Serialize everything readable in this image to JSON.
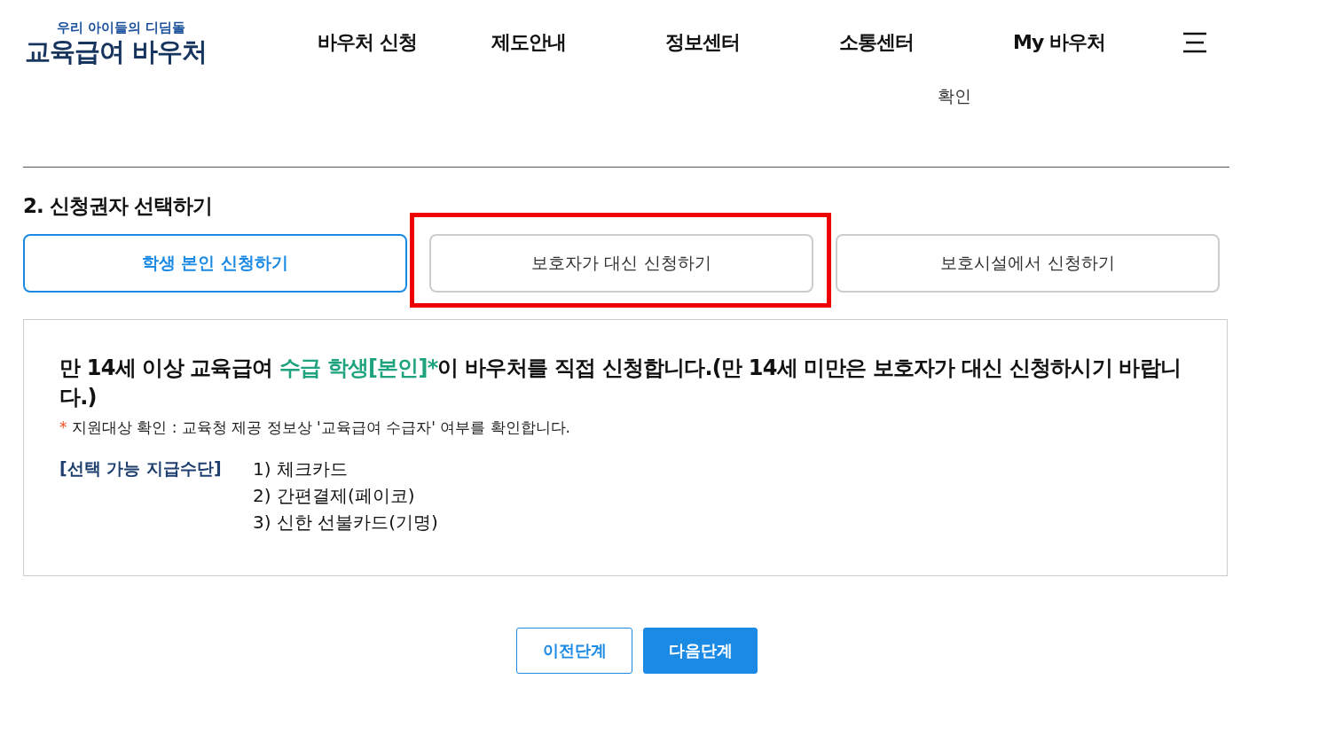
{
  "header": {
    "logo_tagline": "우리 아이들의 디딤돌",
    "logo_title": "교육급여 바우처",
    "nav": [
      "바우처 신청",
      "제도안내",
      "정보센터",
      "소통센터",
      "My 바우처"
    ]
  },
  "confirm_text": "확인",
  "section_title": "2. 신청권자 선택하기",
  "tabs": [
    {
      "label": "학생 본인 신청하기",
      "selected": true,
      "highlighted": false
    },
    {
      "label": "보호자가 대신 신청하기",
      "selected": false,
      "highlighted": true
    },
    {
      "label": "보호시설에서 신청하기",
      "selected": false,
      "highlighted": false
    }
  ],
  "panel": {
    "headline_parts": [
      {
        "text": "만 14세 이상 교육급여 ",
        "accent": false
      },
      {
        "text": "수급 학생[본인]*",
        "accent": true
      },
      {
        "text": "이 바우처를 직접 신청합니다.(만 14세 미만은 보호자가 대신 신청하시기 바랍니다.)",
        "accent": false
      }
    ],
    "note_mark": "*",
    "note": "지원대상 확인 : 교육청 제공 정보상 '교육급여 수급자' 여부를 확인합니다.",
    "methods_label": "[선택 가능 지급수단]",
    "methods": [
      "1) 체크카드",
      "2) 간편결제(페이코)",
      "3) 신한 선불카드(기명)"
    ]
  },
  "buttons": [
    {
      "label": "이전단계",
      "kind": "secondary"
    },
    {
      "label": "다음단계",
      "kind": "primary"
    }
  ]
}
